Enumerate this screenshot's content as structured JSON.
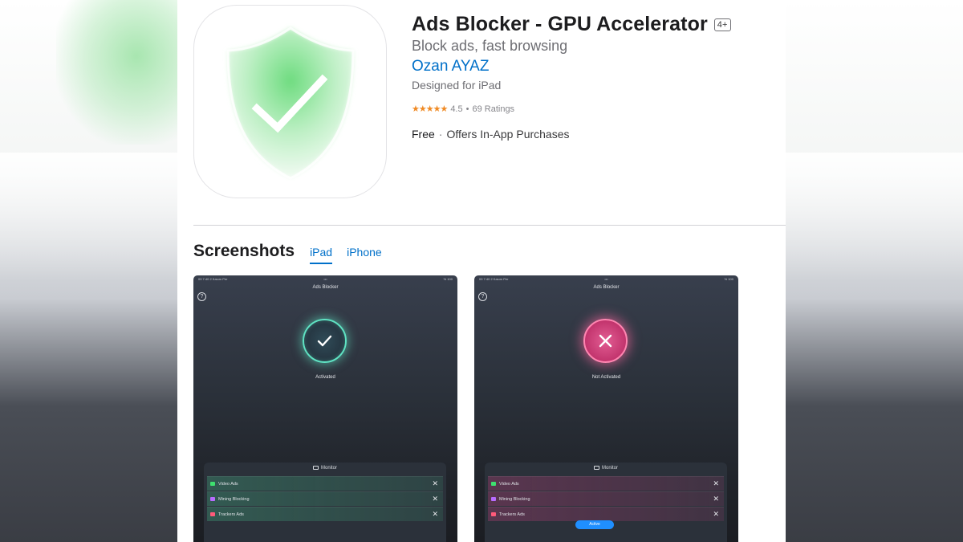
{
  "app": {
    "title": "Ads Blocker - GPU Accelerator",
    "age_rating": "4+",
    "subtitle": "Block ads, fast browsing",
    "developer": "Ozan AYAZ",
    "designed_for": "Designed for iPad",
    "rating_value": "4.5",
    "rating_count": "69 Ratings",
    "stars": "★★★★★",
    "price": "Free",
    "iap_note": "Offers In-App Purchases",
    "dot": "·",
    "bullet": "•"
  },
  "screenshots": {
    "title": "Screenshots",
    "tabs": [
      {
        "label": "iPad",
        "active": true
      },
      {
        "label": "iPhone",
        "active": false
      }
    ],
    "items": [
      {
        "status_left": "09 7:40  2 Kasım Per",
        "status_mid": "•••",
        "status_right": "% 100",
        "nav_title": "Ads Blocker",
        "help": "?",
        "state_label": "Activated",
        "state_icon": "checkmark-icon",
        "monitor_title": "Monitor",
        "rows": [
          {
            "label": "Video Ads",
            "icon": "video-icon",
            "color": "#3ee06f"
          },
          {
            "label": "Mining Blocking",
            "icon": "cube-icon",
            "color": "#b86cff"
          },
          {
            "label": "Trackers Ads",
            "icon": "tracker-icon",
            "color": "#ff5a7a"
          }
        ],
        "remove": "✕"
      },
      {
        "status_left": "09 7:40  2 Kasım Per",
        "status_mid": "•••",
        "status_right": "% 100",
        "nav_title": "Ads Blocker",
        "help": "?",
        "state_label": "Not Activated",
        "state_icon": "x-icon",
        "monitor_title": "Monitor",
        "rows": [
          {
            "label": "Video Ads",
            "icon": "video-icon",
            "color": "#3ee06f"
          },
          {
            "label": "Mining Blocking",
            "icon": "cube-icon",
            "color": "#b86cff"
          },
          {
            "label": "Trackers Ads",
            "icon": "tracker-icon",
            "color": "#ff5a7a"
          }
        ],
        "remove": "✕",
        "button_label": "Active"
      }
    ]
  },
  "colors": {
    "link": "#0070c9",
    "star": "#f08a24",
    "activated": "#5fe3c3",
    "not_activated": "#ff5c9a"
  }
}
